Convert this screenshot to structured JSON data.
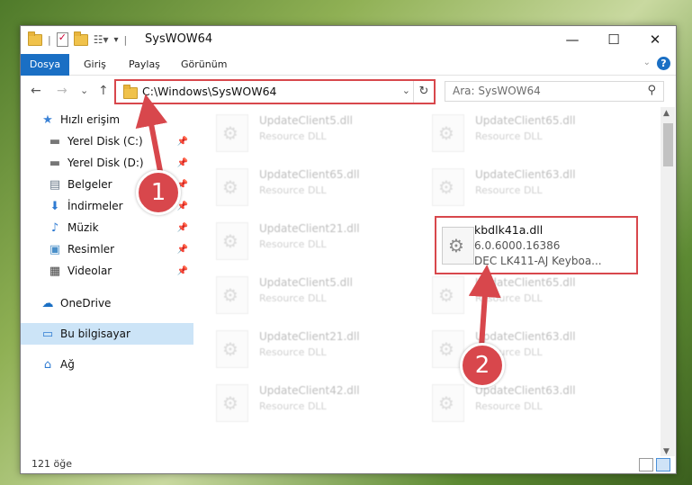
{
  "window": {
    "title": "SysWOW64",
    "controls": {
      "minimize": "—",
      "maximize": "☐",
      "close": "✕"
    }
  },
  "ribbon": {
    "tabs": [
      "Dosya",
      "Giriş",
      "Paylaş",
      "Görünüm"
    ],
    "help": "?"
  },
  "nav": {
    "back": "←",
    "forward": "→",
    "recent": "⌄",
    "up": "↑",
    "address": "C:\\Windows\\SysWOW64",
    "refresh": "↻",
    "search_placeholder": "Ara: SysWOW64"
  },
  "sidebar": {
    "items": [
      {
        "label": "Hızlı erişim",
        "icon": "★",
        "pinned": false,
        "selected": false
      },
      {
        "label": "Yerel Disk (C:)",
        "icon": "▬",
        "pinned": true,
        "selected": false
      },
      {
        "label": "Yerel Disk (D:)",
        "icon": "▬",
        "pinned": true,
        "selected": false
      },
      {
        "label": "Belgeler",
        "icon": "▤",
        "pinned": true,
        "selected": false
      },
      {
        "label": "İndirmeler",
        "icon": "⬇",
        "pinned": true,
        "selected": false
      },
      {
        "label": "Müzik",
        "icon": "♪",
        "pinned": true,
        "selected": false
      },
      {
        "label": "Resimler",
        "icon": "▣",
        "pinned": true,
        "selected": false
      },
      {
        "label": "Videolar",
        "icon": "▦",
        "pinned": true,
        "selected": false
      },
      {
        "label": "OneDrive",
        "icon": "☁",
        "pinned": false,
        "selected": false
      },
      {
        "label": "Bu bilgisayar",
        "icon": "▭",
        "pinned": false,
        "selected": true
      },
      {
        "label": "Ağ",
        "icon": "⌂",
        "pinned": false,
        "selected": false
      }
    ]
  },
  "files": [
    {
      "name": "UpdateClient5.dll",
      "desc": "Resource DLL"
    },
    {
      "name": "UpdateClient65.dll",
      "desc": "Resource DLL"
    },
    {
      "name": "UpdateClient65.dll",
      "desc": "Resource DLL"
    },
    {
      "name": "UpdateClient63.dll",
      "desc": "Resource DLL"
    },
    {
      "name": "UpdateClient21.dll",
      "desc": "Resource DLL"
    },
    {
      "name": "UpdateClient5.dll",
      "desc": "Resource DLL"
    },
    {
      "name": "UpdateClient65.dll",
      "desc": "Resource DLL"
    },
    {
      "name": "UpdateClient21.dll",
      "desc": "Resource DLL"
    },
    {
      "name": "UpdateClient63.dll",
      "desc": "Resource DLL"
    },
    {
      "name": "UpdateClient42.dll",
      "desc": "Resource DLL"
    },
    {
      "name": "UpdateClient63.dll",
      "desc": "Resource DLL"
    }
  ],
  "highlighted_file": {
    "name": "kbdlk41a.dll",
    "version": "6.0.6000.16386",
    "desc": "DEC LK411-AJ Keyboa..."
  },
  "status": {
    "count": "121 öğe"
  },
  "annotations": {
    "step1": "1",
    "step2": "2",
    "color": "#d8474c"
  }
}
